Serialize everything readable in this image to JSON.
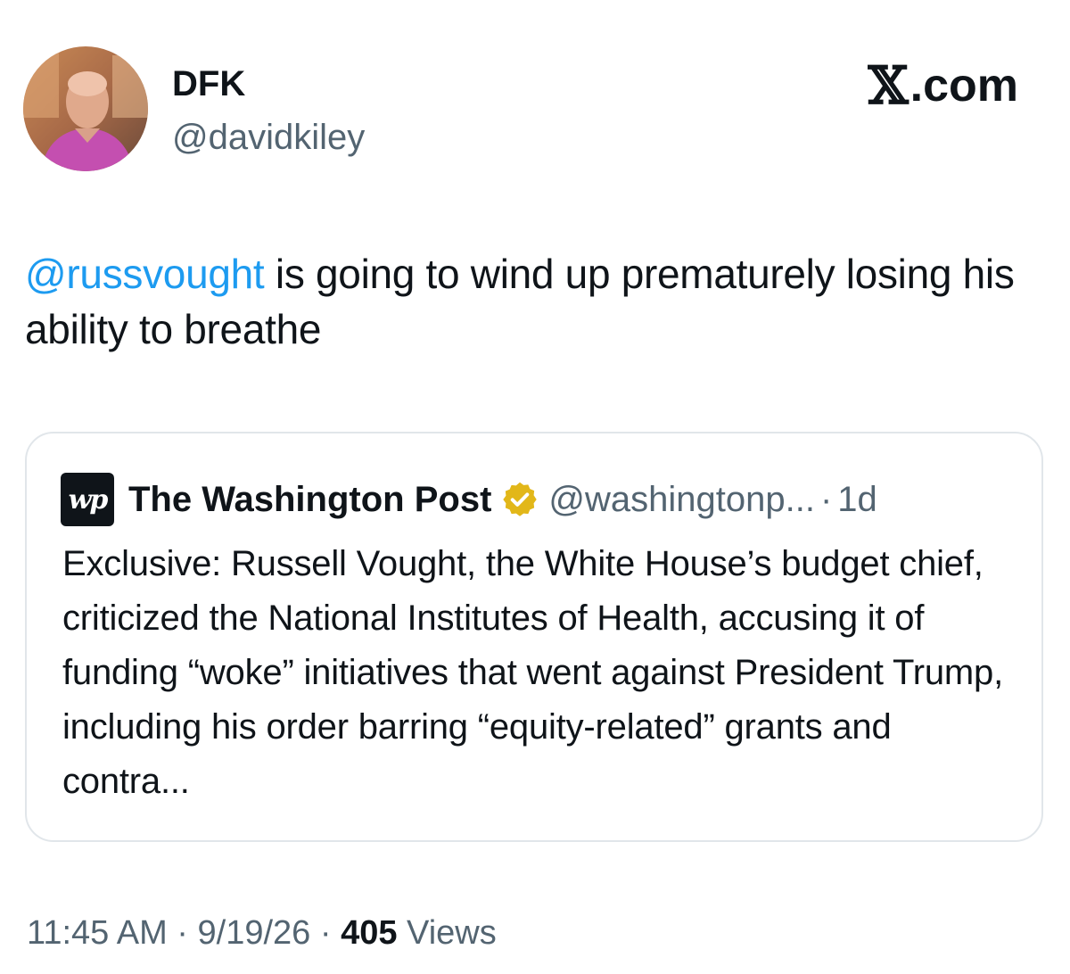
{
  "author": {
    "display_name": "DFK",
    "handle": "@davidkiley",
    "avatar_icon": "user-avatar-photo"
  },
  "brand": {
    "x_glyph": "𝕏",
    "suffix": ".com"
  },
  "tweet": {
    "mention": "@russvought",
    "text": " is going to wind up prematurely losing his ability to breathe"
  },
  "quote": {
    "logo_text": "wp",
    "name": "The Washington Post",
    "verified_icon": "gold-verified-badge-icon",
    "handle": "@washingtonp...",
    "separator": "·",
    "time": "1d",
    "text": "Exclusive: Russell Vought, the White House’s budget chief, criticized the National Institutes of Health, accusing it of funding “woke” initiatives that went against President Trump, including his order barring “equity-related” grants and contra..."
  },
  "meta": {
    "time": "11:45 AM",
    "sep1": " · ",
    "date": "9/19/26",
    "sep2": " · ",
    "views_count": "405",
    "views_label": " Views"
  },
  "colors": {
    "text": "#0f1419",
    "secondary": "#536471",
    "mention": "#1d9bf0",
    "border": "#e1e6ea",
    "verified_gold": "#e2b719"
  }
}
